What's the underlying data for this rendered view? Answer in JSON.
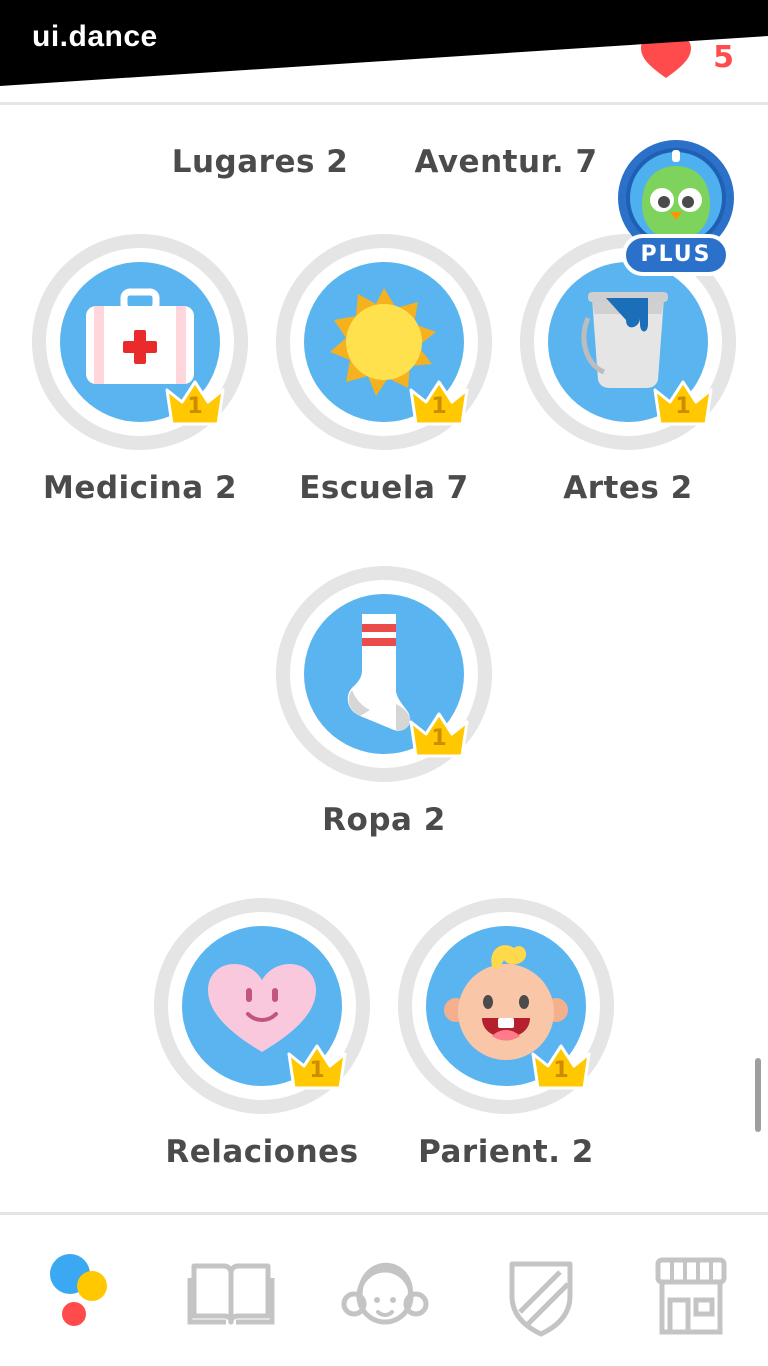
{
  "banner": {
    "text": "ui.dance"
  },
  "header": {
    "hearts_count": "5"
  },
  "top_labels": [
    "Lugares 2",
    "Aventur. 7"
  ],
  "plus": {
    "label": "PLUS"
  },
  "skills": [
    {
      "name": "Medicina 2",
      "icon": "first-aid-kit-icon",
      "crown_level": "1"
    },
    {
      "name": "Escuela 7",
      "icon": "sun-icon",
      "crown_level": "1"
    },
    {
      "name": "Artes 2",
      "icon": "paint-bucket-icon",
      "crown_level": "1"
    },
    {
      "name": "Ropa 2",
      "icon": "sock-icon",
      "crown_level": "1"
    },
    {
      "name": "Relaciones",
      "icon": "heart-face-icon",
      "crown_level": "1"
    },
    {
      "name": "Parient. 2",
      "icon": "baby-icon",
      "crown_level": "1"
    }
  ],
  "bottom_nav": [
    {
      "name": "learn",
      "icon": "learn-dots-icon"
    },
    {
      "name": "stories",
      "icon": "book-icon"
    },
    {
      "name": "profile",
      "icon": "avatar-icon"
    },
    {
      "name": "leagues",
      "icon": "shield-icon"
    },
    {
      "name": "shop",
      "icon": "shop-icon"
    }
  ],
  "colors": {
    "skill_blue": "#5ab4ef",
    "crown_gold": "#ffc800",
    "heart_red": "#ff4b4b",
    "plus_blue": "#2b70c9",
    "label_gray": "#4b4b4b"
  }
}
